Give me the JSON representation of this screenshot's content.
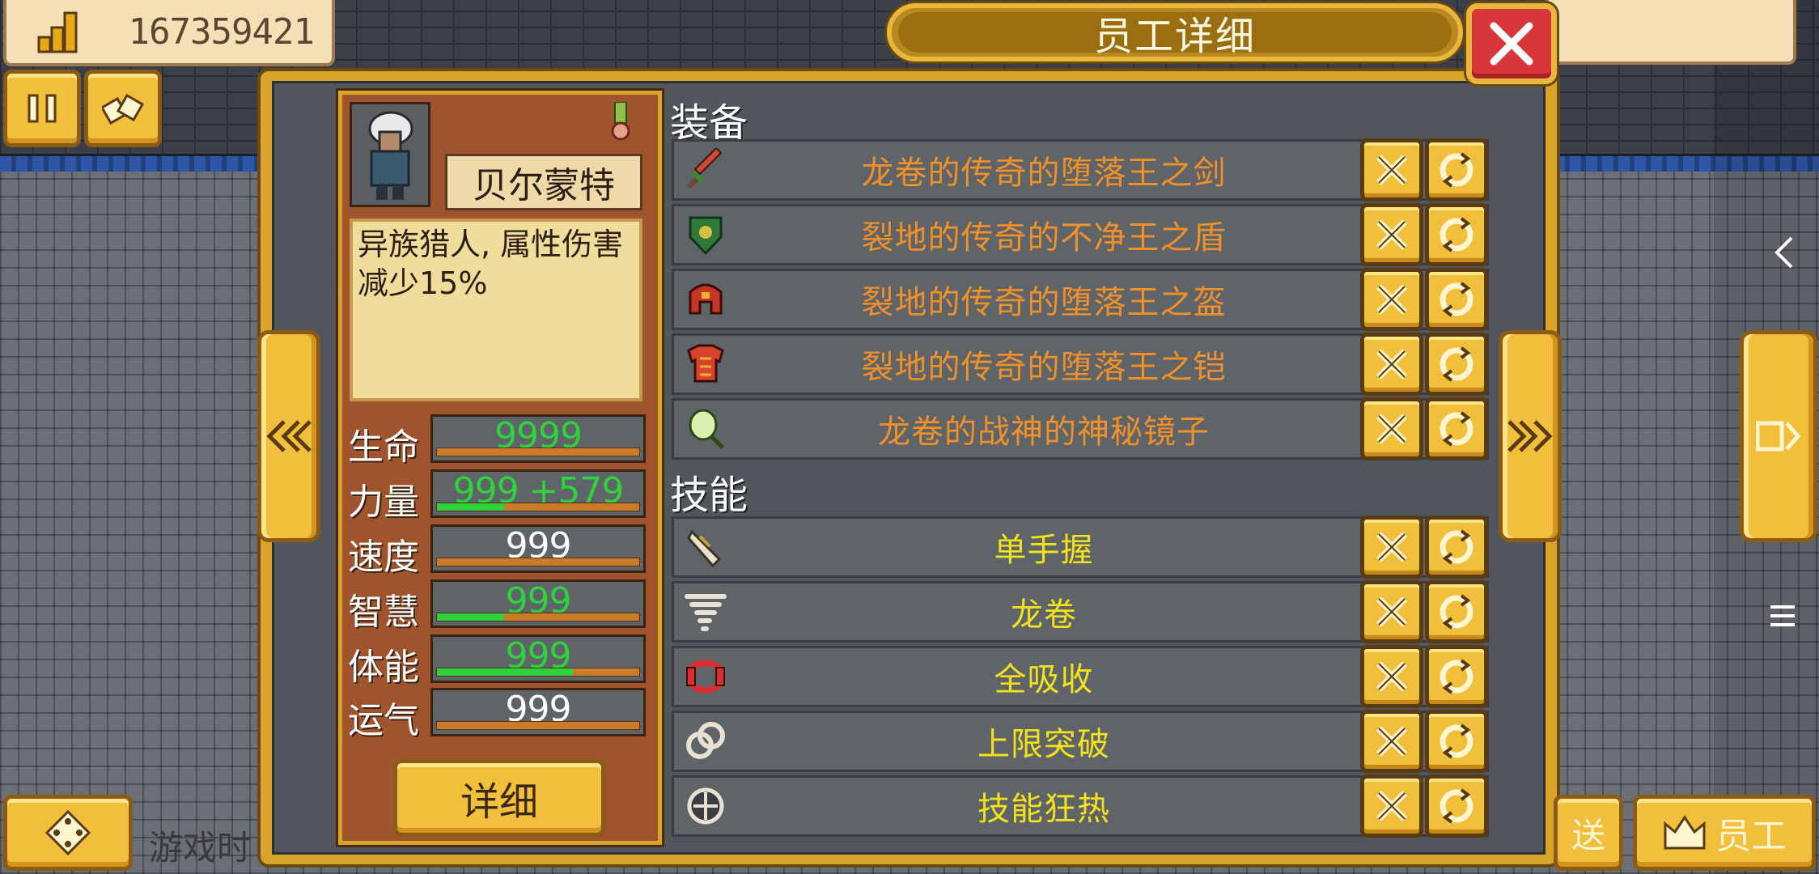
{
  "hud": {
    "money_icon": "coins-stack-icon",
    "money": "167359421",
    "pause_icon": "pause-icon",
    "items_icon": "items-icon",
    "bottom_left_icon": "dpad-icon",
    "bottom_left_text": "游戏时",
    "bottom_right_partial": "送",
    "staff_icon": "crown-icon",
    "staff_label": "员工"
  },
  "system_nav": {
    "back_icon": "chevron-left-icon",
    "home_icon": "square-icon",
    "menu_icon": "menu-icon"
  },
  "dialog": {
    "title": "员工详细",
    "close_icon": "close-icon",
    "prev_icon": "double-chevron-left-icon",
    "next_icon": "double-chevron-right-icon"
  },
  "character": {
    "name": "贝尔蒙特",
    "description": "异族猎人, 属性伤害减少15%",
    "medal_icon": "medal-icon",
    "detail_button": "详细",
    "stats": [
      {
        "label": "生命",
        "value": "9999",
        "color": "#2fd23c",
        "fill": 0.0
      },
      {
        "label": "力量",
        "value": "999 +579",
        "color": "#2fd23c",
        "fill": 0.33
      },
      {
        "label": "速度",
        "value": "999",
        "color": "#ffffff",
        "fill": 0.0
      },
      {
        "label": "智慧",
        "value": "999",
        "color": "#2fd23c",
        "fill": 0.33
      },
      {
        "label": "体能",
        "value": "999",
        "color": "#2fd23c",
        "fill": 0.67
      },
      {
        "label": "运气",
        "value": "999",
        "color": "#ffffff",
        "fill": 0.0
      }
    ]
  },
  "equipment": {
    "title": "装备",
    "text_color": "#f0902a",
    "items": [
      {
        "name": "龙卷的传奇的堕落王之剑",
        "icon": "sword-icon"
      },
      {
        "name": "裂地的传奇的不净王之盾",
        "icon": "shield-icon"
      },
      {
        "name": "裂地的传奇的堕落王之盔",
        "icon": "helmet-icon"
      },
      {
        "name": "裂地的传奇的堕落王之铠",
        "icon": "armor-icon"
      },
      {
        "name": "龙卷的战神的神秘镜子",
        "icon": "mirror-icon"
      }
    ]
  },
  "skills": {
    "title": "技能",
    "text_color": "#f2e21c",
    "items": [
      {
        "name": "单手握",
        "icon": "hand-grip-icon"
      },
      {
        "name": "龙卷",
        "icon": "tornado-icon"
      },
      {
        "name": "全吸收",
        "icon": "absorb-icon"
      },
      {
        "name": "上限突破",
        "icon": "limit-break-icon"
      },
      {
        "name": "技能狂热",
        "icon": "frenzy-icon"
      }
    ]
  },
  "row_buttons": {
    "remove_icon": "x-icon",
    "swap_icon": "swap-icon"
  }
}
